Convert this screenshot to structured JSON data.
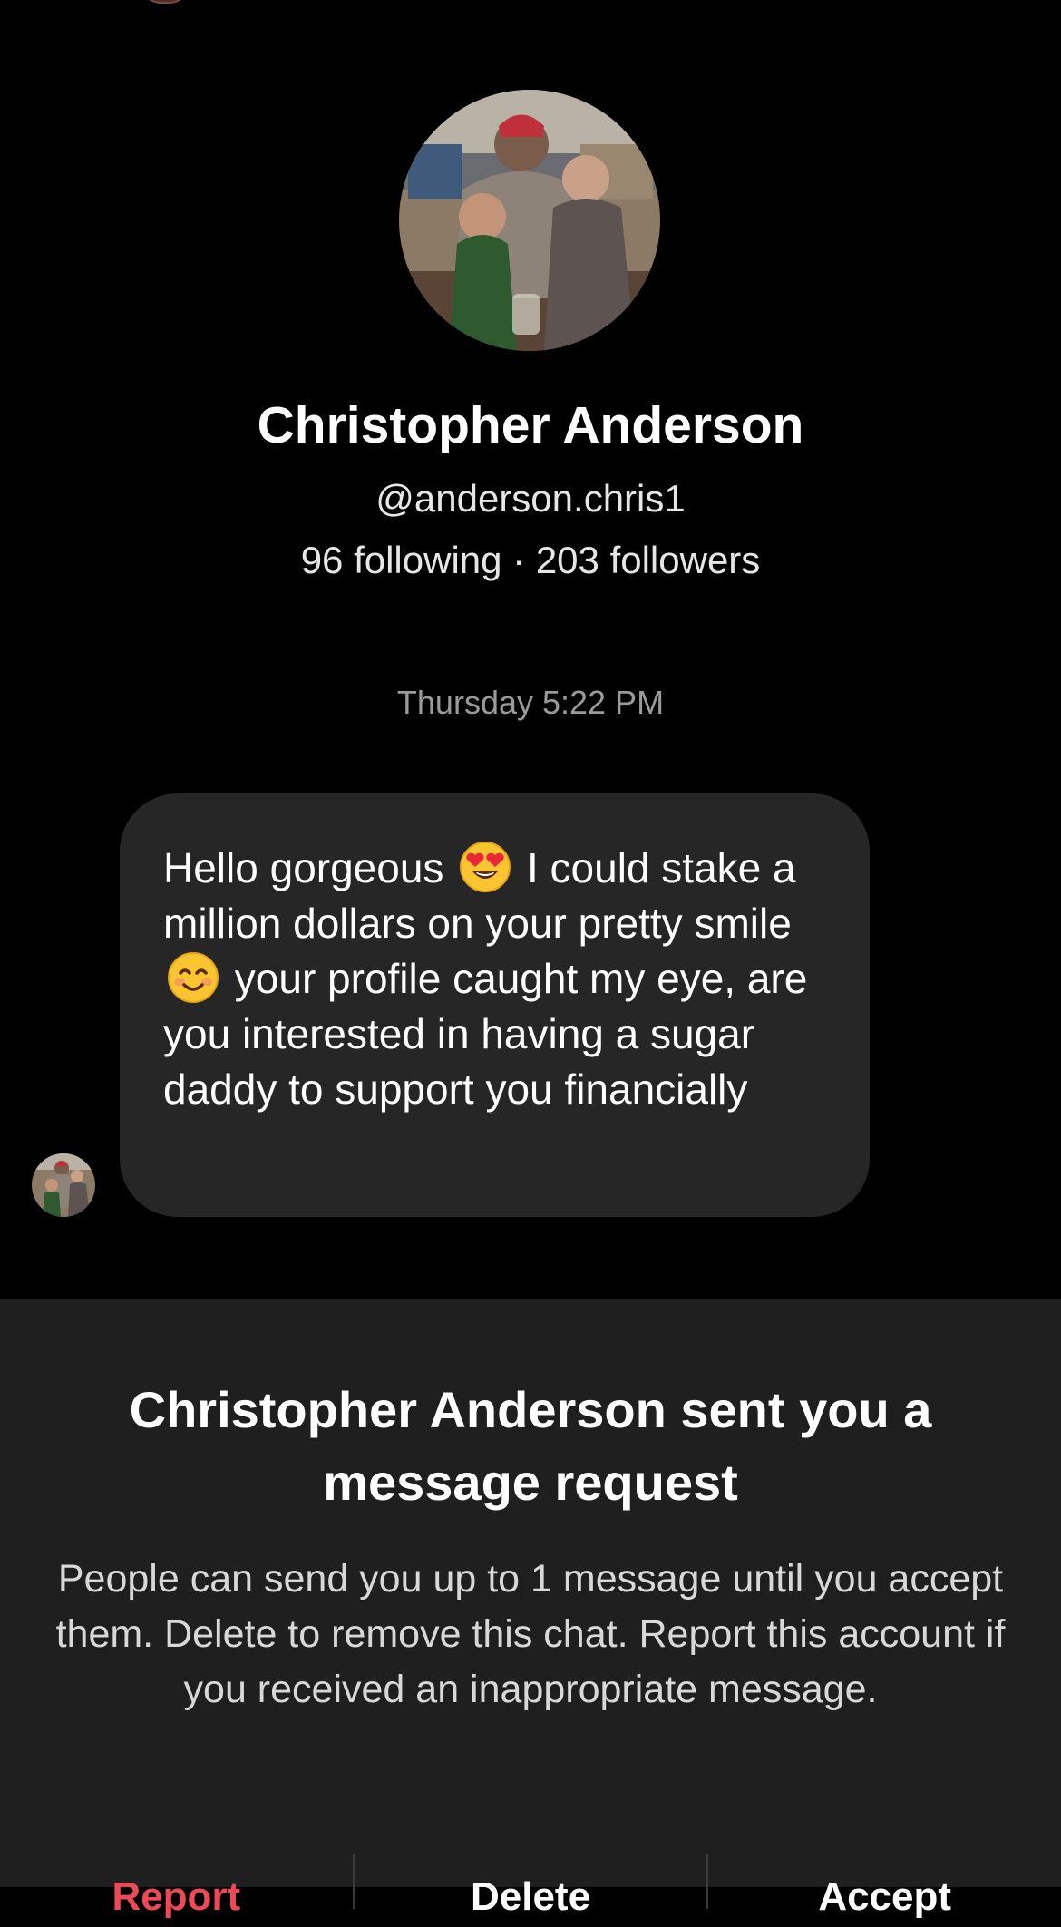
{
  "profile": {
    "name": "Christopher Anderson",
    "handle": "@anderson.chris1",
    "stats": "96 following · 203 followers",
    "photo_icon": "profile-photo-icon"
  },
  "chat": {
    "timestamp": "Thursday 5:22 PM",
    "message": {
      "part1": "Hello gorgeous",
      "emoji1": "heart-eyes-emoji",
      "part2": "I could stake a million dollars on your pretty smile",
      "emoji2": "smiling-face-emoji",
      "part3": "your profile caught my eye, are you interested in having a sugar daddy to support you financially"
    }
  },
  "request": {
    "title": "Christopher Anderson sent you a message request",
    "description": "People can send you up to 1 message until you accept them. Delete to remove this chat. Report this account if you received an inappropriate message.",
    "actions": {
      "report": "Report",
      "delete": "Delete",
      "accept": "Accept"
    }
  },
  "colors": {
    "background": "#000000",
    "bubble": "#262626",
    "panel": "#1f1f1f",
    "report": "#ed4956",
    "muted": "#9a9a9a"
  }
}
